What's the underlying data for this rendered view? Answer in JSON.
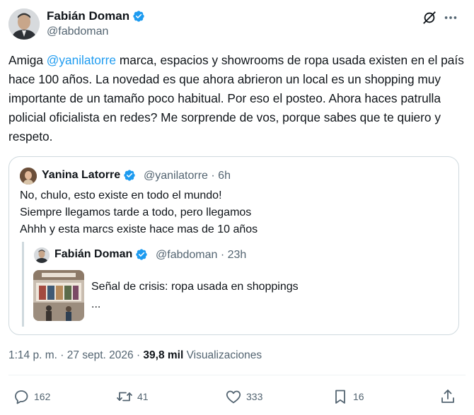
{
  "author": {
    "name": "Fabián Doman",
    "handle": "@fabdoman"
  },
  "tweet": {
    "text_before": "Amiga ",
    "mention": "@yanilatorre",
    "text_after": " marca, espacios y showrooms de ropa usada existen en el país hace 100 años. La novedad es que ahora abrieron un local es un shopping muy importante de un tamaño poco habitual. Por eso el posteo. Ahora haces patrulla policial oficialista en redes? Me sorprende de vos, porque sabes que te quiero y respeto."
  },
  "quote": {
    "name": "Yanina Latorre",
    "meta": "@yanilatorre · 6h",
    "lines": [
      "No, chulo, esto existe en todo el mundo!",
      "Siempre llegamos tarde a todo, pero llegamos",
      "Ahhh y esta marcs existe hace mas de 10 años"
    ],
    "nested": {
      "name": "Fabián Doman",
      "meta": "@fabdoman · 23h",
      "text": "Señal de crisis: ropa usada en shoppings",
      "ellipsis": "..."
    }
  },
  "meta": {
    "timestamp": "1:14 p. m. · 27 sept. 2026 · ",
    "views_count": "39,8 mil",
    "views_label": " Visualizaciones"
  },
  "actions": {
    "replies": "162",
    "reposts": "41",
    "likes": "333",
    "bookmarks": "16"
  },
  "colors": {
    "accent": "#1d9bf0",
    "secondary_text": "#536471",
    "border": "#cfd9de"
  }
}
